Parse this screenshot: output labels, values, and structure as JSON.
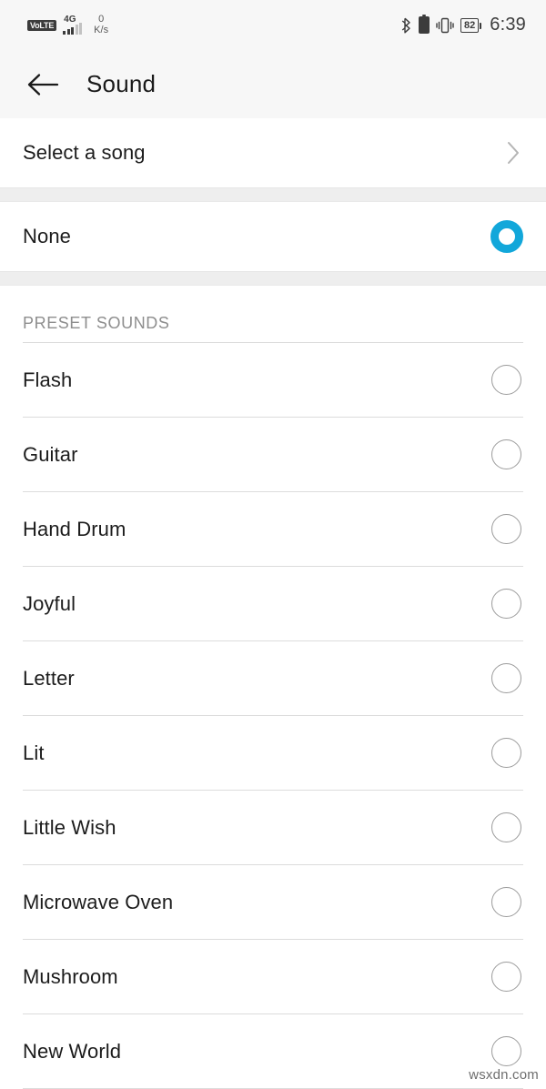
{
  "status_bar": {
    "volte_label": "VoLTE",
    "network_type": "4G",
    "signal_icon": "signal-bars-icon",
    "net_speed_value": "0",
    "net_speed_unit": "K/s",
    "bluetooth_icon": "bluetooth-icon",
    "battery_secondary_icon": "battery-icon",
    "vibrate_icon": "vibrate-icon",
    "battery_percent": "82",
    "time": "6:39"
  },
  "app_bar": {
    "back_icon": "back-arrow-icon",
    "title": "Sound"
  },
  "select_song": {
    "label": "Select a song",
    "chevron_icon": "chevron-right-icon"
  },
  "none_option": {
    "label": "None",
    "selected": true
  },
  "preset_section": {
    "header": "PRESET SOUNDS",
    "items": [
      {
        "label": "Flash",
        "selected": false
      },
      {
        "label": "Guitar",
        "selected": false
      },
      {
        "label": "Hand Drum",
        "selected": false
      },
      {
        "label": "Joyful",
        "selected": false
      },
      {
        "label": "Letter",
        "selected": false
      },
      {
        "label": "Lit",
        "selected": false
      },
      {
        "label": "Little Wish",
        "selected": false
      },
      {
        "label": "Microwave Oven",
        "selected": false
      },
      {
        "label": "Mushroom",
        "selected": false
      },
      {
        "label": "New World",
        "selected": false
      }
    ]
  },
  "watermark": "wsxdn.com",
  "colors": {
    "accent": "#12a7da",
    "text_primary": "#1c1c1c",
    "text_secondary": "#8e8e8e",
    "bar_background": "#f7f7f7",
    "gap_background": "#eeeeee",
    "divider": "#dcdcdc"
  }
}
